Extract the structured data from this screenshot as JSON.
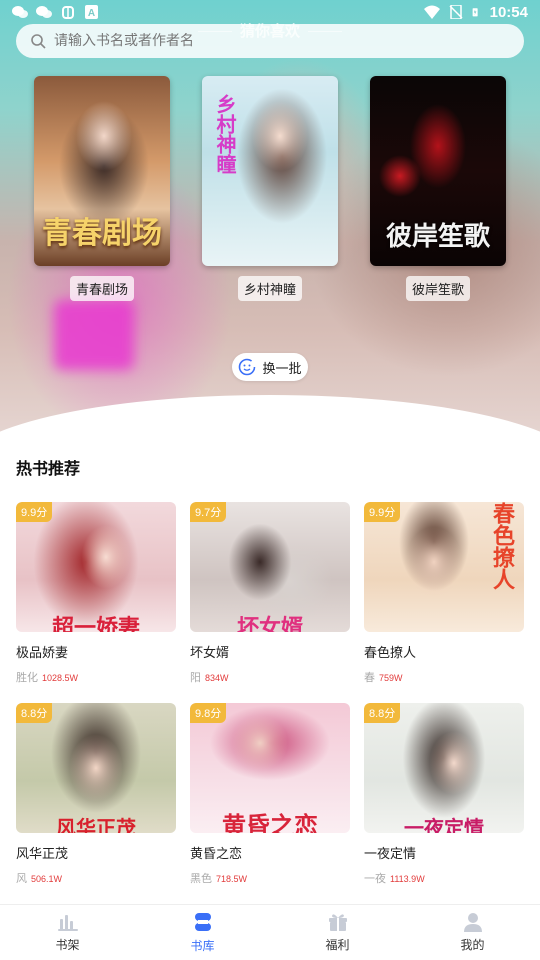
{
  "status_bar": {
    "time": "10:54",
    "icons": [
      "wechat-icon",
      "wechat-icon",
      "bug-icon",
      "font-app-icon",
      "wifi-icon",
      "sim-off-icon",
      "battery-charging-icon"
    ]
  },
  "search": {
    "placeholder": "请输入书名或者作者名"
  },
  "guess": {
    "title": "猜你喜欢",
    "books": [
      {
        "label": "青春剧场",
        "cover_text": "青春剧场"
      },
      {
        "label": "乡村神瞳",
        "cover_text": "乡村神瞳"
      },
      {
        "label": "彼岸笙歌",
        "cover_text": "彼岸笙歌"
      }
    ],
    "refresh_label": "换一批"
  },
  "hot": {
    "title": "热书推荐",
    "books": [
      {
        "title": "极品娇妻",
        "score": "9.9分",
        "author": "胜化",
        "count": "1028.5W",
        "cover_text": "超一娇妻"
      },
      {
        "title": "坏女婿",
        "score": "9.7分",
        "author": "阳",
        "count": "834W",
        "cover_text": "坏女婿"
      },
      {
        "title": "春色撩人",
        "score": "9.9分",
        "author": "春",
        "count": "759W",
        "cover_text": "春色撩人"
      },
      {
        "title": "风华正茂",
        "score": "8.8分",
        "author": "风",
        "count": "506.1W",
        "cover_text": "风华正茂"
      },
      {
        "title": "黄昏之恋",
        "score": "9.8分",
        "author": "黑色",
        "count": "718.5W",
        "cover_text": "黄昏之恋"
      },
      {
        "title": "一夜定情",
        "score": "8.8分",
        "author": "一夜",
        "count": "1113.9W",
        "cover_text": "一夜定情"
      }
    ]
  },
  "tabs": [
    {
      "label": "书架",
      "icon": "bookshelf-icon",
      "active": false
    },
    {
      "label": "书库",
      "icon": "library-icon",
      "active": true
    },
    {
      "label": "福利",
      "icon": "gift-icon",
      "active": false
    },
    {
      "label": "我的",
      "icon": "profile-icon",
      "active": false
    }
  ],
  "colors": {
    "accent": "#3a6ff7",
    "score_badge": "#f2b93b",
    "count": "#e23b3b"
  }
}
